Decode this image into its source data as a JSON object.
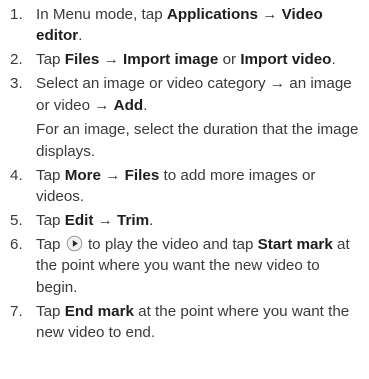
{
  "steps": [
    {
      "number": "1.",
      "segments": [
        {
          "t": "In Menu mode, tap "
        },
        {
          "t": "Applications",
          "b": true
        },
        {
          "t": " → "
        },
        {
          "t": "Video editor",
          "b": true
        },
        {
          "t": "."
        }
      ]
    },
    {
      "number": "2.",
      "segments": [
        {
          "t": "Tap "
        },
        {
          "t": "Files",
          "b": true
        },
        {
          "t": " → "
        },
        {
          "t": "Import image",
          "b": true
        },
        {
          "t": " or "
        },
        {
          "t": "Import video",
          "b": true
        },
        {
          "t": "."
        }
      ]
    },
    {
      "number": "3.",
      "segments": [
        {
          "t": "Select an image or video category → an image or video → "
        },
        {
          "t": "Add",
          "b": true
        },
        {
          "t": "."
        }
      ],
      "note": "For an image, select the duration that the image displays."
    },
    {
      "number": "4.",
      "segments": [
        {
          "t": "Tap "
        },
        {
          "t": "More",
          "b": true
        },
        {
          "t": " → "
        },
        {
          "t": "Files",
          "b": true
        },
        {
          "t": " to add more images or videos."
        }
      ]
    },
    {
      "number": "5.",
      "segments": [
        {
          "t": "Tap "
        },
        {
          "t": "Edit",
          "b": true
        },
        {
          "t": " → "
        },
        {
          "t": "Trim",
          "b": true
        },
        {
          "t": "."
        }
      ]
    },
    {
      "number": "6.",
      "segments": [
        {
          "t": "Tap "
        },
        {
          "icon": "play-icon"
        },
        {
          "t": " to play the video and tap "
        },
        {
          "t": "Start mark",
          "b": true
        },
        {
          "t": " at the point where you want the new video to begin."
        }
      ]
    },
    {
      "number": "7.",
      "segments": [
        {
          "t": "Tap "
        },
        {
          "t": "End mark",
          "b": true
        },
        {
          "t": " at the point where you want the new video to end."
        }
      ]
    }
  ]
}
